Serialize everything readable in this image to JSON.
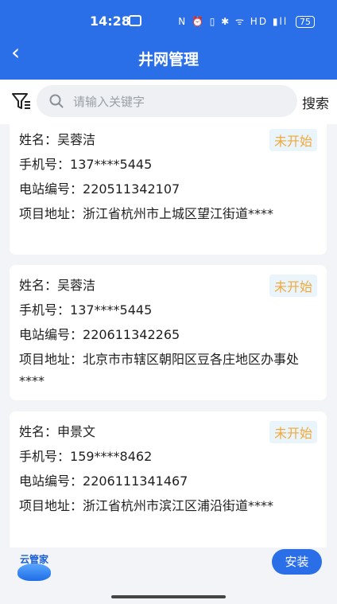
{
  "status": {
    "time": "14:28",
    "right": "N ⏰ ▯ ✱ ᯤ HD ▮ll",
    "battery": "75"
  },
  "header": {
    "title": "井网管理"
  },
  "search": {
    "placeholder": "请输入关键字",
    "button": "搜索"
  },
  "labels": {
    "name": "姓名：",
    "phone": "手机号：",
    "station": "电站编号：",
    "address": "项目地址："
  },
  "cards": [
    {
      "name": "吴蓉洁",
      "phone": "137****5445",
      "station": "220511342107",
      "address": "浙江省杭州市上城区望江街道****",
      "status": "未开始"
    },
    {
      "name": "吴蓉洁",
      "phone": "137****5445",
      "station": "220611342265",
      "address": "北京市市辖区朝阳区豆各庄地区办事处****",
      "status": "未开始"
    },
    {
      "name": "申景文",
      "phone": "159****8462",
      "station": "2206111341467",
      "address": "浙江省杭州市滨江区浦沿街道****",
      "status": "未开始"
    }
  ],
  "bottom": {
    "logo_text": "云管家",
    "install": "安装"
  },
  "colors": {
    "primary": "#2b6fe8",
    "badge_text": "#f0a83b",
    "badge_bg": "#eaf5fb"
  }
}
